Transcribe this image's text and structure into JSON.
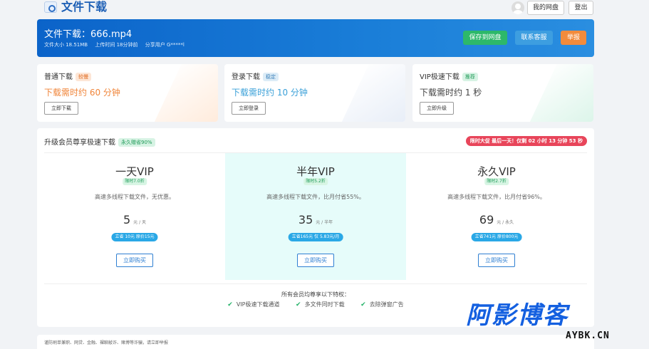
{
  "header": {
    "brand": "文件下载",
    "my_drive": "我的网盘",
    "logout": "登出"
  },
  "file": {
    "title": "文件下载：666.mp4",
    "size": "文件大小 18.51MB",
    "upload_time": "上传时间 18分钟前",
    "sharer": "分享用户 G*****l",
    "save_btn": "保存到网盘",
    "contact_btn": "联系客服",
    "report_btn": "举报",
    "colors": {
      "save": "#2db86a",
      "contact": "#3d9ee0",
      "report": "#f28b3c"
    }
  },
  "download_options": [
    {
      "title": "普通下载",
      "tag": "较慢",
      "time": "下载需时约 60 分钟",
      "button": "立即下载",
      "time_color": "#f0853a",
      "tag_bg": "#fde6d6",
      "tag_color": "#e06a20"
    },
    {
      "title": "登录下载",
      "tag": "稳定",
      "time": "下载需时约 10 分钟",
      "button": "立即登录",
      "time_color": "#3aa0d8",
      "tag_bg": "#dcecf7",
      "tag_color": "#3a7fb8"
    },
    {
      "title": "VIP极速下载",
      "tag": "推荐",
      "time": "下载需时约 1 秒",
      "button": "立即升级",
      "time_color": "#444444",
      "tag_bg": "#d7f3e4",
      "tag_color": "#1f9a57"
    }
  ],
  "vip": {
    "title": "升级会员尊享极速下载",
    "badge": "永久赠省90%",
    "countdown": "限时大促 最后一天！仅剩 02 小时 13 分钟 53 秒",
    "plans": [
      {
        "name": "一天VIP",
        "discount": "限时7.0折",
        "desc": "高速多线程下载文件，无优惠。",
        "price": "5",
        "unit": "元 / 天",
        "save": "立省 10元 原价15元",
        "button": "立即购买"
      },
      {
        "name": "半年VIP",
        "discount": "限时5.2折",
        "desc": "高速多线程下载文件，比月付省55%。",
        "price": "35",
        "unit": "元 / 半年",
        "save": "立省165元 仅 5.83元/月",
        "button": "立即购买"
      },
      {
        "name": "永久VIP",
        "discount": "限时2.7折",
        "desc": "高速多线程下载文件，比月付省96%。",
        "price": "69",
        "unit": "元 / 永久",
        "save": "立省741元 原价800元",
        "button": "立即购买"
      }
    ],
    "privileges_title": "所有会员均尊享以下特权：",
    "privileges": [
      "VIP极速下载通道",
      "多文件同时下载",
      "去除弹窗广告"
    ]
  },
  "footer": {
    "notice": "谨防刷单兼职、网贷、金融、裸聊敲诈、赌博等诈骗，请立即举报"
  },
  "watermark": {
    "main": "阿影博客",
    "sub": "AYBK.CN"
  }
}
